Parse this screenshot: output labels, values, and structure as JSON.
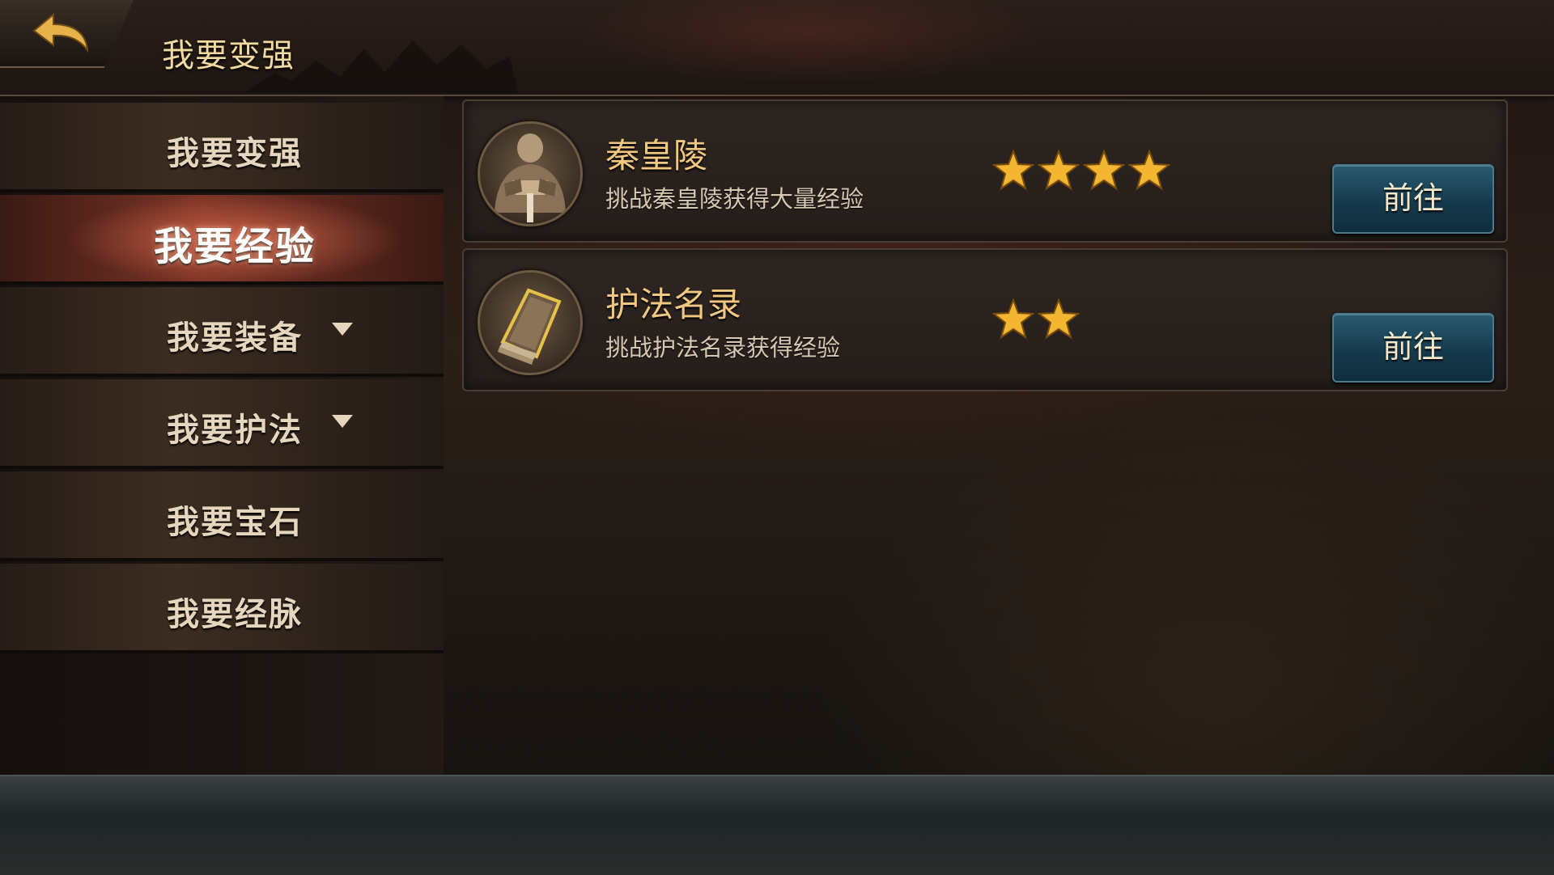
{
  "header": {
    "title": "我要变强"
  },
  "sidebar": {
    "items": [
      {
        "label": "我要变强"
      },
      {
        "label": "我要经验"
      },
      {
        "label": "我要装备"
      },
      {
        "label": "我要护法"
      },
      {
        "label": "我要宝石"
      },
      {
        "label": "我要经脉"
      }
    ],
    "active_index": 1
  },
  "cards": [
    {
      "title": "秦皇陵",
      "desc": "挑战秦皇陵获得大量经验",
      "stars": 4,
      "button": "前往",
      "icon": "warrior-portrait-icon"
    },
    {
      "title": "护法名录",
      "desc": "挑战护法名录获得经验",
      "stars": 2,
      "button": "前往",
      "icon": "book-icon"
    }
  ],
  "colors": {
    "accent_gold": "#f2c77f",
    "button_blue": "#1e4a60",
    "active_red": "#7a3325"
  }
}
